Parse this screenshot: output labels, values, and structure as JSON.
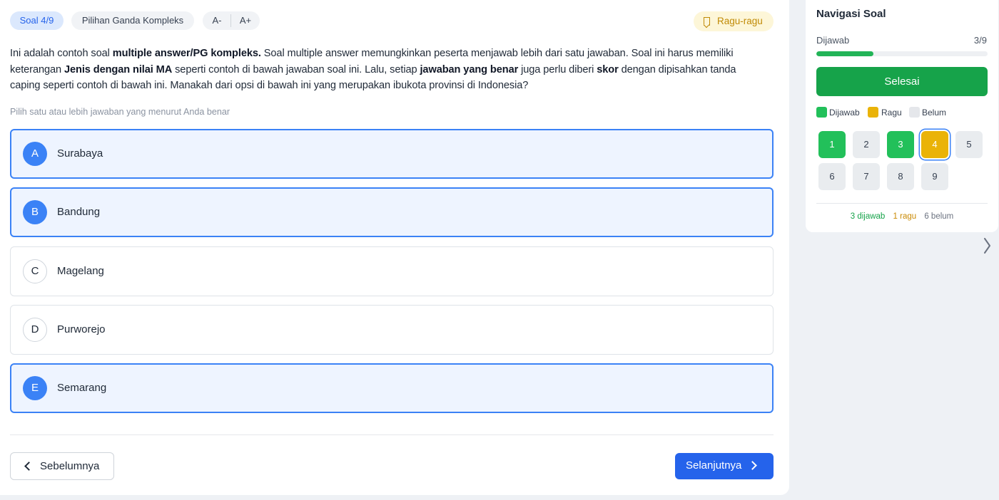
{
  "header": {
    "question_number": "Soal 4/9",
    "question_type": "Pilihan Ganda Kompleks",
    "font_decrease": "A-",
    "font_increase": "A+",
    "doubt_button": "Ragu-ragu"
  },
  "question": {
    "segments": [
      {
        "text": "Ini adalah contoh soal ",
        "bold": false
      },
      {
        "text": "multiple answer/PG kompleks.",
        "bold": true
      },
      {
        "text": " Soal multiple answer memungkinkan peserta menjawab lebih dari satu jawaban. Soal ini harus memiliki keterangan ",
        "bold": false
      },
      {
        "text": "Jenis dengan nilai MA",
        "bold": true
      },
      {
        "text": " seperti contoh di bawah jawaban soal ini. Lalu, setiap ",
        "bold": false
      },
      {
        "text": "jawaban yang benar",
        "bold": true
      },
      {
        "text": " juga perlu diberi ",
        "bold": false
      },
      {
        "text": "skor",
        "bold": true
      },
      {
        "text": " dengan dipisahkan tanda caping seperti contoh di bawah ini. Manakah dari opsi di bawah ini yang merupakan ibukota provinsi di Indonesia?",
        "bold": false
      }
    ],
    "hint": "Pilih satu atau lebih jawaban yang menurut Anda benar"
  },
  "options": [
    {
      "letter": "A",
      "text": "Surabaya",
      "selected": true
    },
    {
      "letter": "B",
      "text": "Bandung",
      "selected": true
    },
    {
      "letter": "C",
      "text": "Magelang",
      "selected": false
    },
    {
      "letter": "D",
      "text": "Purworejo",
      "selected": false
    },
    {
      "letter": "E",
      "text": "Semarang",
      "selected": true
    }
  ],
  "footer": {
    "prev_label": "Sebelumnya",
    "next_label": "Selanjutnya"
  },
  "navigation": {
    "title": "Navigasi Soal",
    "answered_label": "Dijawab",
    "answered_count": "3/9",
    "progress_fraction": 0.333,
    "finish_label": "Selesai",
    "legend": [
      {
        "label": "Dijawab",
        "color": "#22c05a"
      },
      {
        "label": "Ragu",
        "color": "#eab308"
      },
      {
        "label": "Belum",
        "color": "#e5e7eb"
      }
    ],
    "questions": [
      {
        "number": "1",
        "status": "answered"
      },
      {
        "number": "2",
        "status": "unanswered"
      },
      {
        "number": "3",
        "status": "answered"
      },
      {
        "number": "4",
        "status": "doubt",
        "current": true
      },
      {
        "number": "5",
        "status": "unanswered"
      },
      {
        "number": "6",
        "status": "unanswered"
      },
      {
        "number": "7",
        "status": "unanswered"
      },
      {
        "number": "8",
        "status": "unanswered"
      },
      {
        "number": "9",
        "status": "unanswered"
      }
    ],
    "summary": [
      {
        "text": "3 dijawab",
        "color": "#16a34a"
      },
      {
        "text": "1 ragu",
        "color": "#ca8a04"
      },
      {
        "text": "6 belum",
        "color": "#6b7280"
      }
    ]
  },
  "colors": {
    "primary": "#2563eb",
    "success": "#16a34a",
    "warning": "#eab308"
  },
  "icons": {
    "doubt": "bookmark-icon",
    "prev": "chevron-left-icon",
    "next": "chevron-right-icon",
    "collapse": "chevron-right-icon"
  }
}
